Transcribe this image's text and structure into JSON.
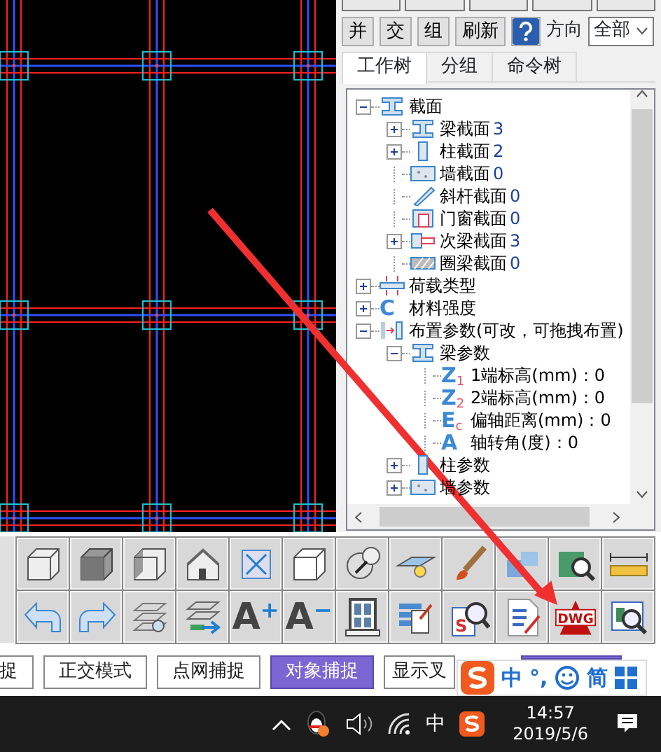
{
  "panel": {
    "buttons": [
      "并",
      "交",
      "组",
      "刷新"
    ],
    "direction_label": "方向",
    "direction_value": "全部",
    "tabs": [
      {
        "label": "工作树",
        "selected": true
      },
      {
        "label": "分组",
        "selected": false
      },
      {
        "label": "命令树",
        "selected": false
      }
    ],
    "tree": [
      {
        "label": "截面",
        "kind": "i-beam",
        "expanded": true,
        "children": [
          {
            "label": "梁截面",
            "count": "3",
            "kind": "i-beam",
            "expanded": false
          },
          {
            "label": "柱截面",
            "count": "2",
            "kind": "column",
            "expanded": false
          },
          {
            "label": "墙截面",
            "count": "0",
            "kind": "wall"
          },
          {
            "label": "斜杆截面",
            "count": "0",
            "kind": "brace"
          },
          {
            "label": "门窗截面",
            "count": "0",
            "kind": "window-frame"
          },
          {
            "label": "次梁截面",
            "count": "3",
            "kind": "secondary-beam",
            "expanded": false
          },
          {
            "label": "圈梁截面",
            "count": "0",
            "kind": "ring-beam"
          }
        ]
      },
      {
        "label": "荷载类型",
        "kind": "load",
        "expanded": false
      },
      {
        "label": "材料强度",
        "kind": "letter",
        "icon_text": "C",
        "expanded": false
      },
      {
        "label": "布置参数(可改，可拖拽布置)",
        "kind": "layout",
        "expanded": true,
        "children": [
          {
            "label": "梁参数",
            "kind": "i-beam",
            "expanded": true,
            "children": [
              {
                "label": "1端标高(mm)：0",
                "kind": "letter",
                "icon_text": "Z$_{1}$"
              },
              {
                "label": "2端标高(mm)：0",
                "kind": "letter",
                "icon_text": "Z$_{2}$"
              },
              {
                "label": "偏轴距离(mm)：0",
                "kind": "letter",
                "icon_text": "E$_{c}$"
              },
              {
                "label": "轴转角(度)：0",
                "kind": "letter",
                "icon_text": "A"
              }
            ]
          },
          {
            "label": "柱参数",
            "kind": "column",
            "expanded": false
          },
          {
            "label": "墙参数",
            "kind": "wall",
            "expanded": false
          }
        ]
      }
    ]
  },
  "toolbar": [
    {
      "kind": "wire-cube"
    },
    {
      "kind": "solid-cube"
    },
    {
      "kind": "side-cube"
    },
    {
      "kind": "house"
    },
    {
      "kind": "zoom-extents"
    },
    {
      "kind": "box"
    },
    {
      "kind": "orbit"
    },
    {
      "kind": "plane-light"
    },
    {
      "kind": "brush"
    },
    {
      "kind": "blocks"
    },
    {
      "kind": "section-zoom"
    },
    {
      "kind": "ruler"
    },
    {
      "kind": "undo"
    },
    {
      "kind": "redo"
    },
    {
      "kind": "layers-light"
    },
    {
      "kind": "layers-arrow"
    },
    {
      "kind": "font",
      "label": "A",
      "sign": "+"
    },
    {
      "kind": "font",
      "label": "A",
      "sign": "−"
    },
    {
      "kind": "window"
    },
    {
      "kind": "stack-edit"
    },
    {
      "kind": "search-sheet",
      "label": "S"
    },
    {
      "kind": "checklist"
    },
    {
      "kind": "dwg",
      "label": "DWG"
    },
    {
      "kind": "detail-zoom"
    }
  ],
  "status_buttons": [
    {
      "label": "捉",
      "selected": false
    },
    {
      "label": "正交模式",
      "selected": false
    },
    {
      "label": "点网捕捉",
      "selected": false
    },
    {
      "label": "对象捕捉",
      "selected": true
    },
    {
      "label": "显示叉",
      "selected": false
    },
    {
      "selected": true
    }
  ],
  "ime_bar": {
    "mode": "中",
    "punct": "°,",
    "script": "简"
  },
  "taskbar": {
    "ime": "中",
    "time": "14:57",
    "date": "2019/5/6"
  }
}
